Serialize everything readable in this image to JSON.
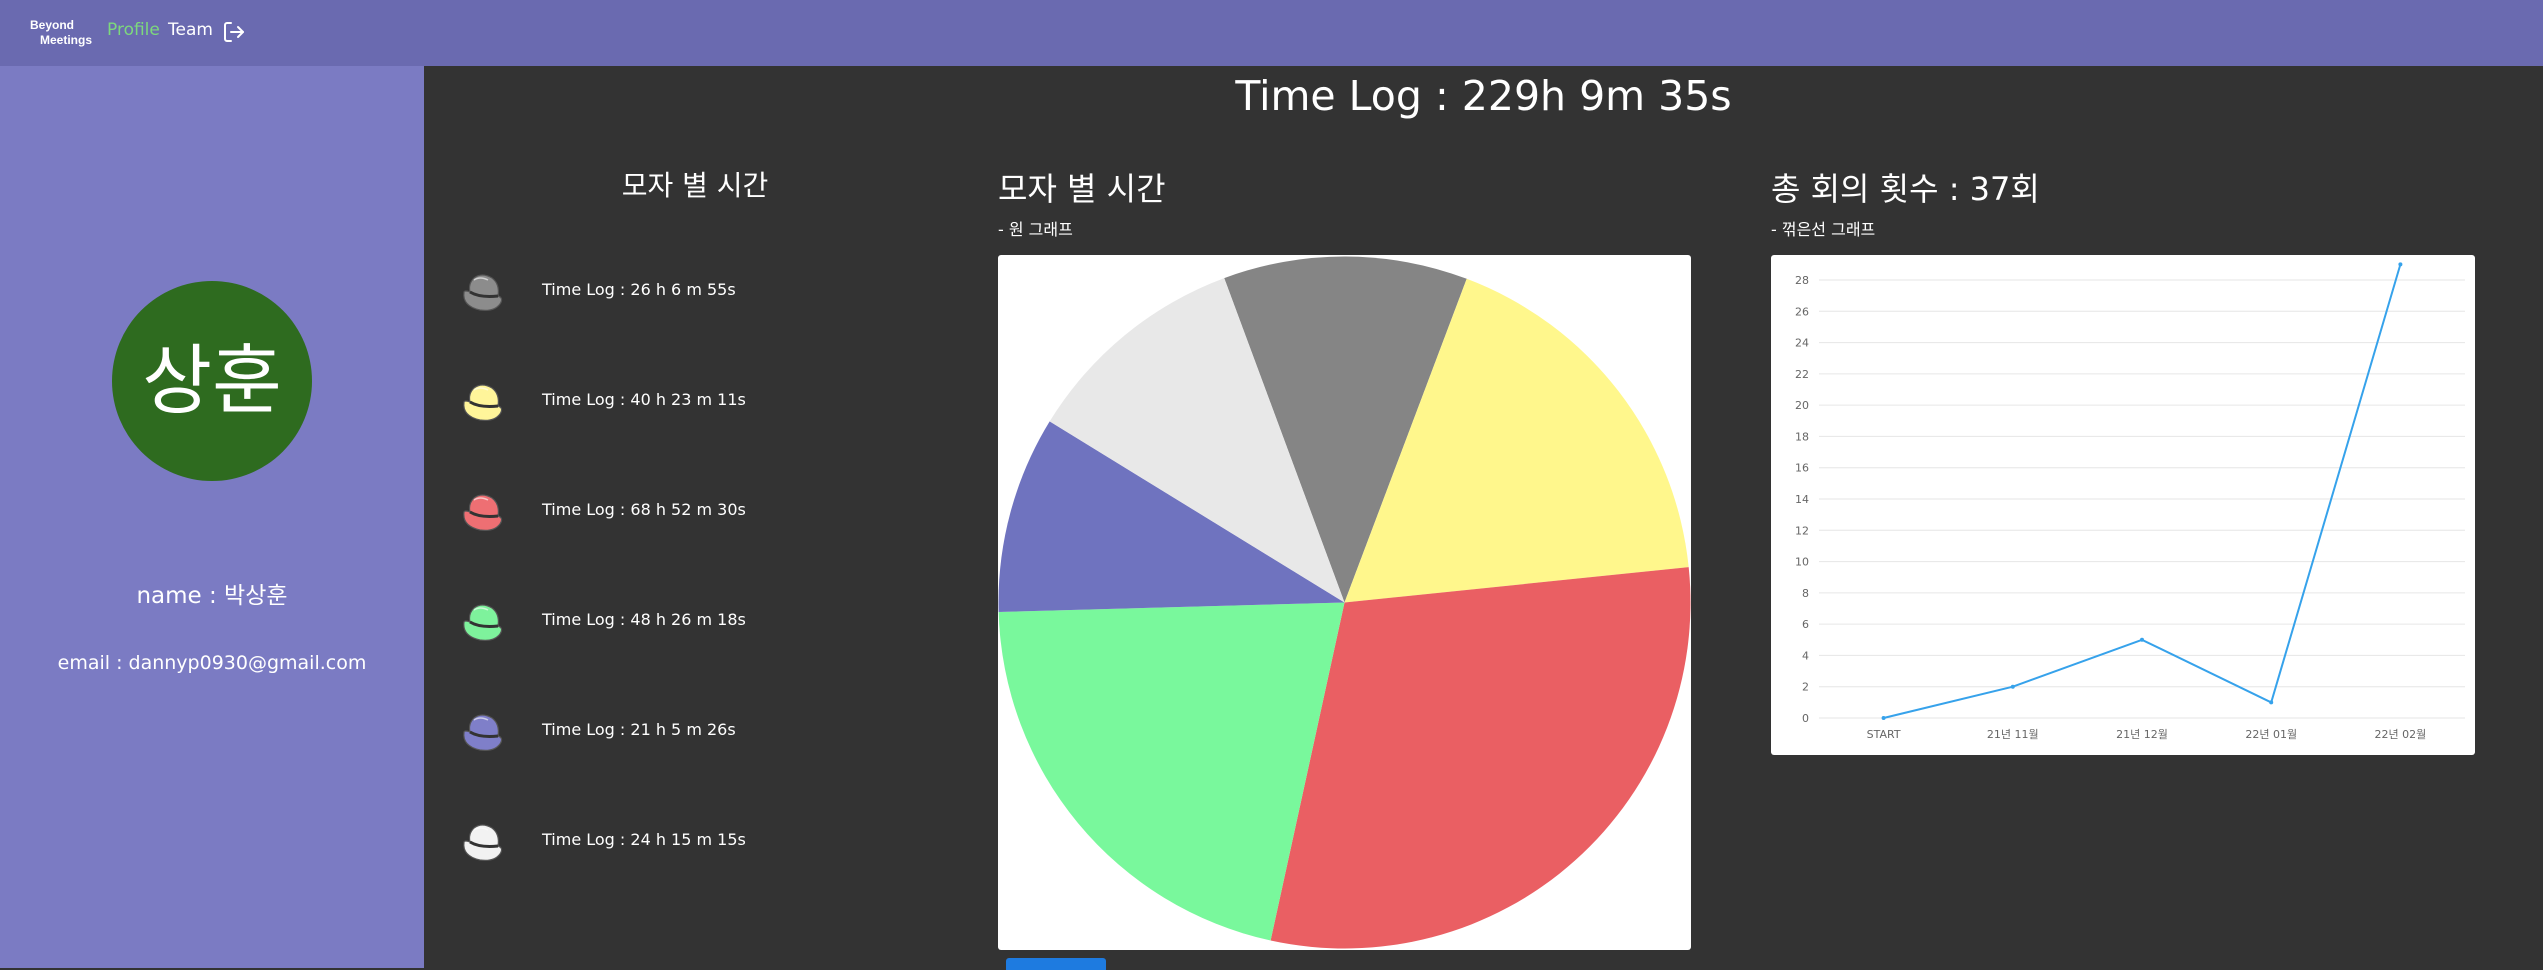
{
  "navbar": {
    "logo_line1": "Beyond",
    "logo_line2": "Meetings",
    "profile_label": "Profile",
    "team_label": "Team",
    "logout_icon": "logout-icon",
    "background": "#6a6ab0",
    "active_color": "#7dd87d"
  },
  "sidebar": {
    "avatar_text": "상훈",
    "avatar_color": "#2e6b1f",
    "name": "name : 박상훈",
    "email": "email : dannyp0930@gmail.com",
    "background": "#7b7bc3"
  },
  "main": {
    "title": "Time Log : 229h 9m 35s",
    "hat_list_title": "모자 별 시간",
    "hats": [
      {
        "icon": "gray-hat-icon",
        "color": "#8c8c8c",
        "text": "Time Log : 26 h 6 m 55s"
      },
      {
        "icon": "yellow-hat-icon",
        "color": "#fff59a",
        "text": "Time Log : 40 h 23 m 11s"
      },
      {
        "icon": "red-hat-icon",
        "color": "#ee6f73",
        "text": "Time Log : 68 h 52 m 30s"
      },
      {
        "icon": "green-hat-icon",
        "color": "#7ef29c",
        "text": "Time Log : 48 h 26 m 18s"
      },
      {
        "icon": "blue-hat-icon",
        "color": "#7f7fc9",
        "text": "Time Log : 21 h 5 m 26s"
      },
      {
        "icon": "white-hat-icon",
        "color": "#f2f2f2",
        "text": "Time Log : 24 h 15 m 15s"
      }
    ],
    "pie_title": "모자 별 시간",
    "pie_subtitle": "- 원 그래프",
    "line_title": "총 회의 횟수 : 37회",
    "line_subtitle": "- 꺾은선 그래프"
  },
  "chart_data": [
    {
      "type": "pie",
      "labels": [],
      "values": [
        26.1153,
        40.3864,
        68.875,
        48.4383,
        21.0906,
        24.2542
      ],
      "colors": [
        "#858585",
        "#fff78c",
        "#ea5f63",
        "#79f89c",
        "#6f73bf",
        "#e8e8e8"
      ]
    },
    {
      "type": "line",
      "categories": [
        "START",
        "21년 11월",
        "21년 12월",
        "22년 01월",
        "22년 02월"
      ],
      "values": [
        0,
        2,
        5,
        1,
        29
      ],
      "ylim": [
        0,
        28
      ],
      "yticks": [
        0,
        2,
        4,
        6,
        8,
        10,
        12,
        14,
        16,
        18,
        20,
        22,
        24,
        26,
        28
      ],
      "grid": true,
      "line_color": "#36a2eb"
    }
  ]
}
